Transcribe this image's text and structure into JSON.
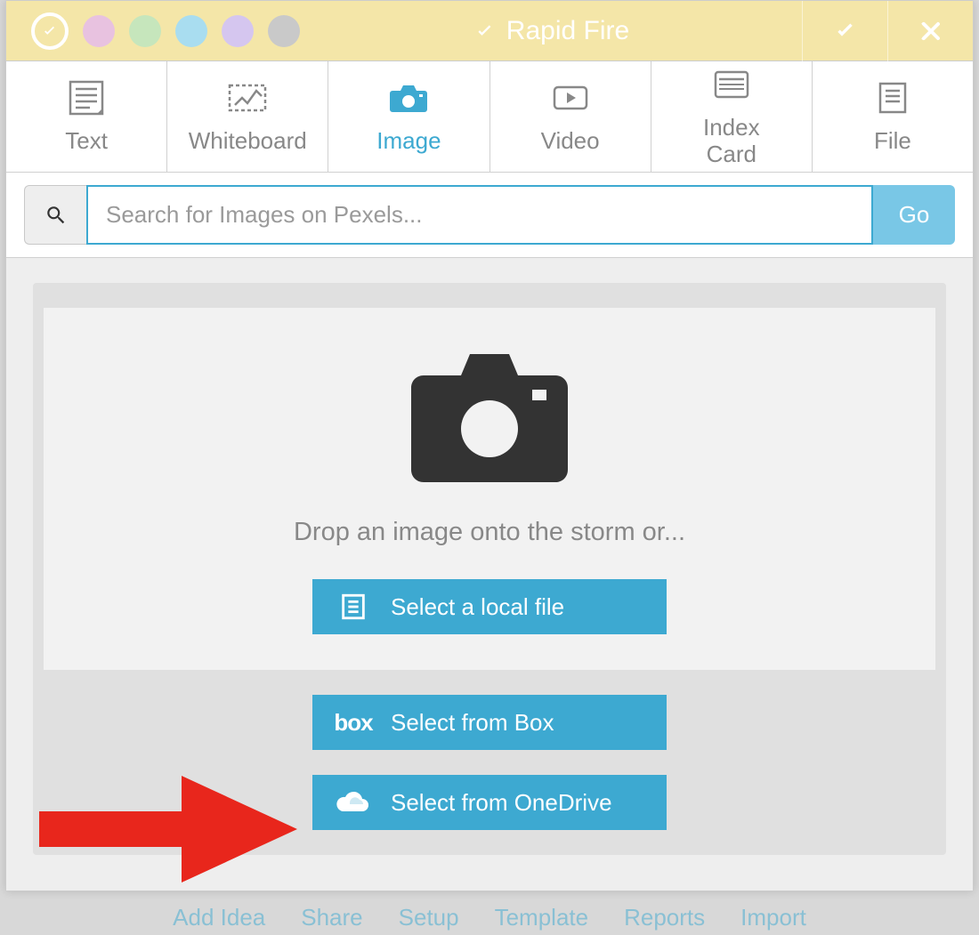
{
  "titlebar": {
    "mode_label": "Rapid Fire",
    "colors": [
      "#e8c2e0",
      "#c6e6bc",
      "#a9ddf0",
      "#d5c6ef",
      "#c9c9c9"
    ]
  },
  "tabs": [
    {
      "id": "text",
      "label": "Text"
    },
    {
      "id": "whiteboard",
      "label": "Whiteboard"
    },
    {
      "id": "image",
      "label": "Image",
      "active": true
    },
    {
      "id": "video",
      "label": "Video"
    },
    {
      "id": "indexcard",
      "label": "Index\nCard"
    },
    {
      "id": "file",
      "label": "File"
    }
  ],
  "search": {
    "placeholder": "Search for Images on Pexels...",
    "go_label": "Go"
  },
  "drop": {
    "prompt": "Drop an image onto the storm or...",
    "local_label": "Select a local file",
    "box_label": "Select from Box",
    "onedrive_label": "Select from OneDrive"
  },
  "bottom_nav": [
    "Add Idea",
    "Share",
    "Setup",
    "Template",
    "Reports",
    "Import"
  ]
}
